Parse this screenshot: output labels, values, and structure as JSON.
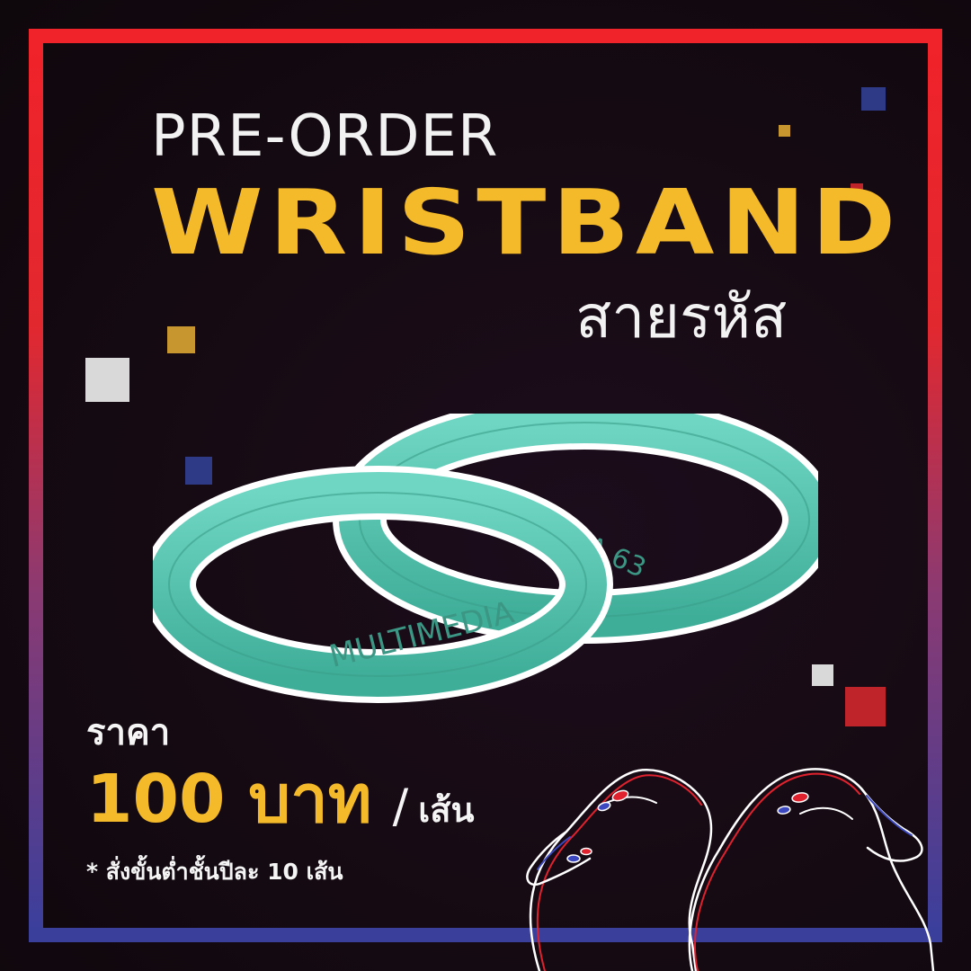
{
  "header": {
    "pre_order": "PRE-ORDER",
    "product": "WRISTBAND",
    "thai_title": "สายรหัส"
  },
  "product_image": {
    "band_front_text": "MULTIMEDIA",
    "band_back_text": "MULTIMEDIA 63",
    "band_color": "#4fc3ad"
  },
  "price": {
    "label": "ราคา",
    "amount": "100 บาท",
    "separator": "/",
    "unit": "เส้น",
    "note": "* สั่งขั้นต่ำชั้นปีละ 10 เส้น"
  },
  "colors": {
    "accent_gold": "#f4ba2a",
    "frame_top": "#f0222a",
    "frame_bottom": "#3b3f9c",
    "text_light": "#f2f2f2"
  }
}
